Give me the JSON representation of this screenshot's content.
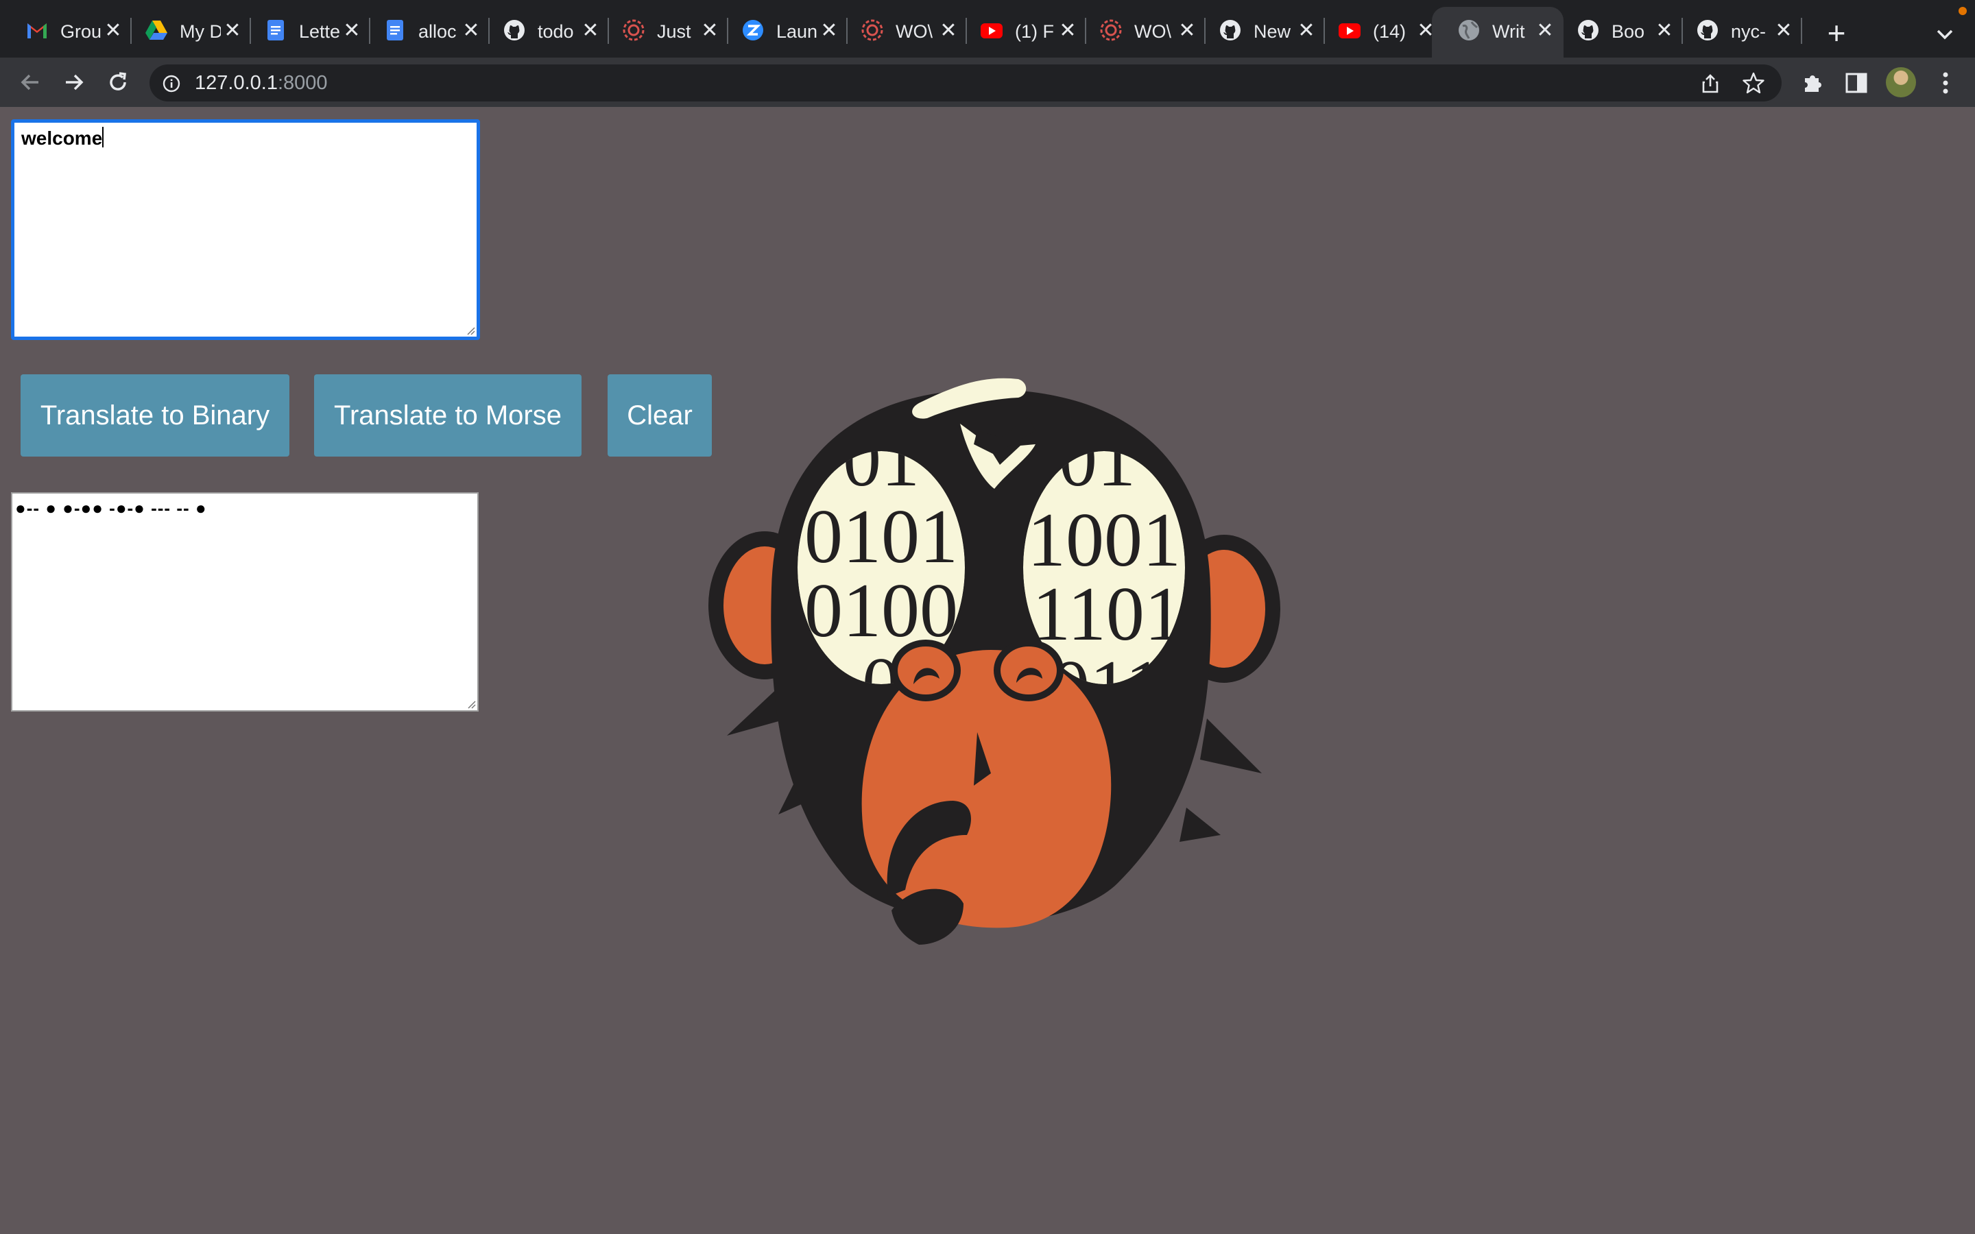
{
  "browser": {
    "tabs": [
      {
        "title": "Grou",
        "icon": "gmail-icon"
      },
      {
        "title": "My D",
        "icon": "google-drive-icon"
      },
      {
        "title": "Lette",
        "icon": "google-docs-icon"
      },
      {
        "title": "alloc",
        "icon": "google-docs-icon"
      },
      {
        "title": "todo",
        "icon": "github-icon"
      },
      {
        "title": "Just",
        "icon": "wheel-icon"
      },
      {
        "title": "Laun",
        "icon": "zoom-icon"
      },
      {
        "title": "WO\\",
        "icon": "wheel-icon"
      },
      {
        "title": "(1) F",
        "icon": "youtube-icon"
      },
      {
        "title": "WO\\",
        "icon": "wheel-icon"
      },
      {
        "title": "New",
        "icon": "github-icon"
      },
      {
        "title": "(14)",
        "icon": "youtube-icon"
      },
      {
        "title": "Writ",
        "icon": "globe-icon",
        "active": true
      },
      {
        "title": "Boo",
        "icon": "github-icon"
      },
      {
        "title": "nyc-",
        "icon": "github-icon"
      }
    ],
    "new_tab_label": "+",
    "close_glyph": "✕",
    "url_host": "127.0.0.1",
    "url_port": ":8000"
  },
  "page": {
    "input_text": "welcome",
    "buttons": {
      "binary": "Translate to Binary",
      "morse": "Translate to Morse",
      "clear": "Clear"
    },
    "output_text": "●-- ● ●-●● -●-● --- -- ●"
  },
  "colors": {
    "page_bg": "#5f575a",
    "button_bg": "#5492ac",
    "focus_ring": "#1a73e8",
    "monkey_orange": "#d96536",
    "monkey_dark": "#222021",
    "eye_cream": "#f8f6da"
  },
  "illustration": {
    "left_eye_digits": [
      "01",
      "0101",
      "0100",
      "0"
    ],
    "right_eye_digits": [
      "01",
      "1001",
      "1101",
      "011"
    ]
  }
}
